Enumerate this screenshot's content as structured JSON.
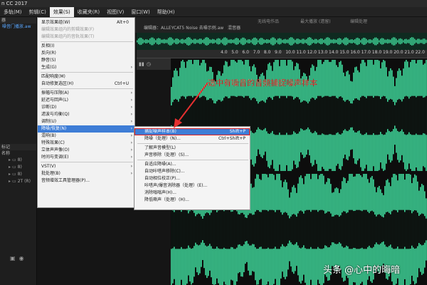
{
  "app": {
    "title": "n CC 2017"
  },
  "menubar": {
    "items": [
      {
        "label": "多轨(M)",
        "active": false
      },
      {
        "label": "剪辑(C)",
        "active": false
      },
      {
        "label": "效果(S)",
        "active": true
      },
      {
        "label": "收藏夹(R)",
        "active": false
      },
      {
        "label": "视图(V)",
        "active": false
      },
      {
        "label": "窗口(W)",
        "active": false
      },
      {
        "label": "帮助(H)",
        "active": false
      }
    ]
  },
  "left_panel": {
    "tab_label": "器",
    "file_label": "噪音门播放.aw",
    "media_tab": "标记",
    "column_header": "名称",
    "rows": [
      "8)",
      "8)",
      "8)",
      "2T (R)"
    ],
    "footer_icons": [
      "folder-icon",
      "mic-icon"
    ]
  },
  "editor": {
    "tab_label": "编辑器：ALLEYCAT5 Noise 去噪示例.aw",
    "tab_label2": "混音器",
    "top_labels": [
      "无线电作品",
      "最大播放 (遗留)",
      "编辑处理"
    ],
    "ruler_ticks": [
      "4.0",
      "5.0",
      "6.0",
      "7.0",
      "8.0",
      "9.0",
      "10.0",
      "11.0",
      "12.0",
      "13.0",
      "14.0",
      "15.0",
      "16.0",
      "17.0",
      "18.0",
      "19.0",
      "20.0",
      "21.0",
      "22.0"
    ]
  },
  "effects_menu": {
    "items": [
      {
        "label": "显示效果组(W)",
        "shortcut": "Alt+0",
        "disabled": false,
        "arrow": false
      },
      {
        "label": "编辑效果组内的剪辑效果(F)",
        "shortcut": "",
        "disabled": true,
        "arrow": false
      },
      {
        "label": "编辑效果组内的音轨效果(T)",
        "shortcut": "",
        "disabled": true,
        "arrow": false
      },
      {
        "label": "SEP"
      },
      {
        "label": "反相(I)",
        "shortcut": "",
        "disabled": false,
        "arrow": false
      },
      {
        "label": "反向(R)",
        "shortcut": "",
        "disabled": false,
        "arrow": false
      },
      {
        "label": "静音(S)",
        "shortcut": "",
        "disabled": false,
        "arrow": false
      },
      {
        "label": "生成(G)",
        "shortcut": "",
        "disabled": false,
        "arrow": true
      },
      {
        "label": "SEP"
      },
      {
        "label": "匹配响度(M)",
        "shortcut": "",
        "disabled": false,
        "arrow": false
      },
      {
        "label": "自动修复选区(H)",
        "shortcut": "Ctrl+U",
        "disabled": false,
        "arrow": false
      },
      {
        "label": "SEP"
      },
      {
        "label": "振幅与压限(A)",
        "shortcut": "",
        "disabled": false,
        "arrow": true
      },
      {
        "label": "延迟与回声(L)",
        "shortcut": "",
        "disabled": false,
        "arrow": true
      },
      {
        "label": "诊断(D)",
        "shortcut": "",
        "disabled": false,
        "arrow": true
      },
      {
        "label": "滤波与均衡(Q)",
        "shortcut": "",
        "disabled": false,
        "arrow": true
      },
      {
        "label": "调制(U)",
        "shortcut": "",
        "disabled": false,
        "arrow": true
      },
      {
        "label": "降噪/恢复(N)",
        "shortcut": "",
        "disabled": false,
        "arrow": true,
        "highlight": true
      },
      {
        "label": "混响(B)",
        "shortcut": "",
        "disabled": false,
        "arrow": true
      },
      {
        "label": "特殊效果(C)",
        "shortcut": "",
        "disabled": false,
        "arrow": true
      },
      {
        "label": "立体声声像(O)",
        "shortcut": "",
        "disabled": false,
        "arrow": true
      },
      {
        "label": "时间与变调(E)",
        "shortcut": "",
        "disabled": false,
        "arrow": true
      },
      {
        "label": "SEP"
      },
      {
        "label": "VST(V)",
        "shortcut": "",
        "disabled": false,
        "arrow": true
      },
      {
        "label": "批处理(B)",
        "shortcut": "",
        "disabled": false,
        "arrow": true
      },
      {
        "label": "音频增效工具管理器(P)...",
        "shortcut": "",
        "disabled": false,
        "arrow": false
      }
    ]
  },
  "noise_submenu": {
    "items": [
      {
        "label": "捕捉噪声样本(B)",
        "shortcut": "Shift+P",
        "highlight": true
      },
      {
        "label": "降噪（处理）(N)...",
        "shortcut": "Ctrl+Shift+P",
        "highlight": false
      },
      {
        "label": "SEP"
      },
      {
        "label": "了解声音模型(L)",
        "shortcut": "",
        "highlight": false
      },
      {
        "label": "声音移除（处理）(S)...",
        "shortcut": "",
        "highlight": false
      },
      {
        "label": "SEP"
      },
      {
        "label": "自适应降噪(A)...",
        "shortcut": "",
        "highlight": false
      },
      {
        "label": "自动咔嗒声移除(C)...",
        "shortcut": "",
        "highlight": false
      },
      {
        "label": "自动相位校正(P)...",
        "shortcut": "",
        "highlight": false
      },
      {
        "label": "咔嗒声/爆音消除器（处理）(E)...",
        "shortcut": "",
        "highlight": false
      },
      {
        "label": "消除嗡嗡声(H)...",
        "shortcut": "",
        "highlight": false
      },
      {
        "label": "降低嘶声（处理）(H)...",
        "shortcut": "",
        "highlight": false
      }
    ]
  },
  "annotation": {
    "text": "选中有噪音的音频捕捉噪声样本",
    "color": "#e53030"
  },
  "watermark": {
    "text": "头条 @心中的晦暗"
  },
  "colors": {
    "waveform": "#3fd89a",
    "highlight": "#3e7dd6",
    "annotation": "#e53030"
  }
}
